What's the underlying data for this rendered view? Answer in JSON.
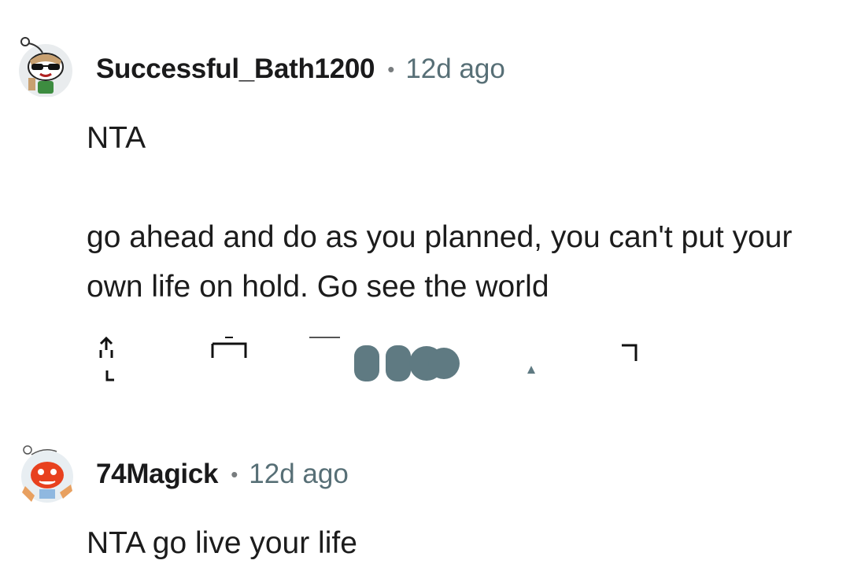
{
  "comments": [
    {
      "username": "Successful_Bath1200",
      "separator": "•",
      "time": "12d ago",
      "text": "NTA\n\ngo ahead and do as you planned, you can't put your own life on hold. Go see the world",
      "avatar_icon": "snoo-avatar-sunglasses-icon"
    },
    {
      "username": "74Magick",
      "separator": "•",
      "time": "12d ago",
      "text": "NTA go live your life",
      "avatar_icon": "snoo-avatar-red-monster-icon"
    }
  ],
  "colors": {
    "username": "#1a1a1b",
    "meta": "#576f76",
    "body": "#1c1c1c",
    "action_icons": "#5f7a82"
  }
}
